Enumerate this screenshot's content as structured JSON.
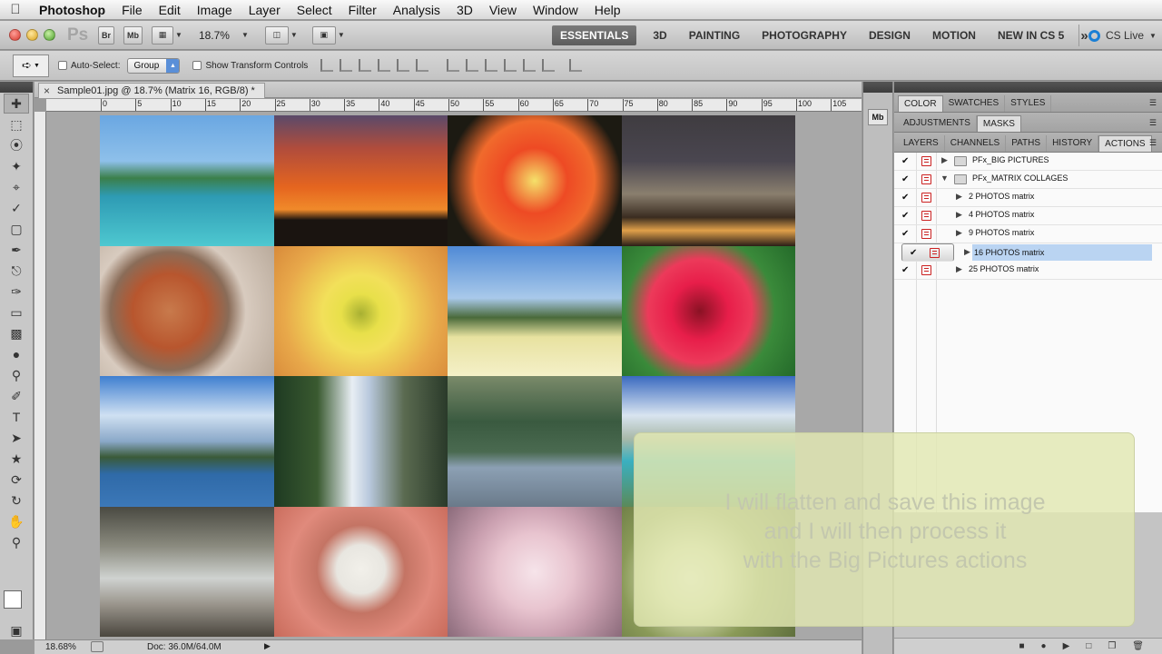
{
  "menubar": {
    "app": "Photoshop",
    "items": [
      "File",
      "Edit",
      "Image",
      "Layer",
      "Select",
      "Filter",
      "Analysis",
      "3D",
      "View",
      "Window",
      "Help"
    ]
  },
  "appbar": {
    "logo": "Ps",
    "bridge": "Br",
    "minibridge": "Mb",
    "zoom": "18.7%",
    "workspaces": [
      "ESSENTIALS",
      "3D",
      "PAINTING",
      "PHOTOGRAPHY",
      "DESIGN",
      "MOTION",
      "NEW IN CS 5"
    ],
    "more": "»",
    "cslive": "CS Live"
  },
  "options": {
    "auto_select": "Auto-Select:",
    "auto_select_value": "Group",
    "show_transform": "Show Transform Controls"
  },
  "document": {
    "tab_title": "Sample01.jpg @ 18.7% (Matrix 16, RGB/8) *",
    "ruler_labels": [
      "0",
      "5",
      "10",
      "15",
      "20",
      "25",
      "30",
      "35",
      "40",
      "45",
      "50",
      "55",
      "60",
      "65",
      "70",
      "75",
      "80",
      "85",
      "90",
      "95",
      "100",
      "105"
    ]
  },
  "status": {
    "zoom": "18.68%",
    "doc": "Doc: 36.0M/64.0M"
  },
  "panels": {
    "row1_tabs": [
      "COLOR",
      "SWATCHES",
      "STYLES"
    ],
    "row2_tabs": [
      "ADJUSTMENTS",
      "MASKS"
    ],
    "row3_tabs": [
      "LAYERS",
      "CHANNELS",
      "PATHS",
      "HISTORY",
      "ACTIONS"
    ],
    "dock_label": "Mb",
    "actions": [
      {
        "name": "PFx_BIG PICTURES",
        "type": "folder",
        "expanded": false
      },
      {
        "name": "PFx_MATRIX COLLAGES",
        "type": "folder",
        "expanded": true
      },
      {
        "name": "2 PHOTOS matrix",
        "type": "action"
      },
      {
        "name": "4 PHOTOS matrix",
        "type": "action"
      },
      {
        "name": "9 PHOTOS matrix",
        "type": "action"
      },
      {
        "name": "16 PHOTOS matrix",
        "type": "action",
        "selected": true
      },
      {
        "name": "25 PHOTOS matrix",
        "type": "action"
      }
    ]
  },
  "overlay": {
    "line1": "I will flatten and save this image",
    "line2": "and I will then process it",
    "line3": "with the Big Pictures actions"
  },
  "colors": {
    "accent": "#5a8fd8",
    "selection": "#bad4f2",
    "cslive": "#1a7fd5"
  }
}
